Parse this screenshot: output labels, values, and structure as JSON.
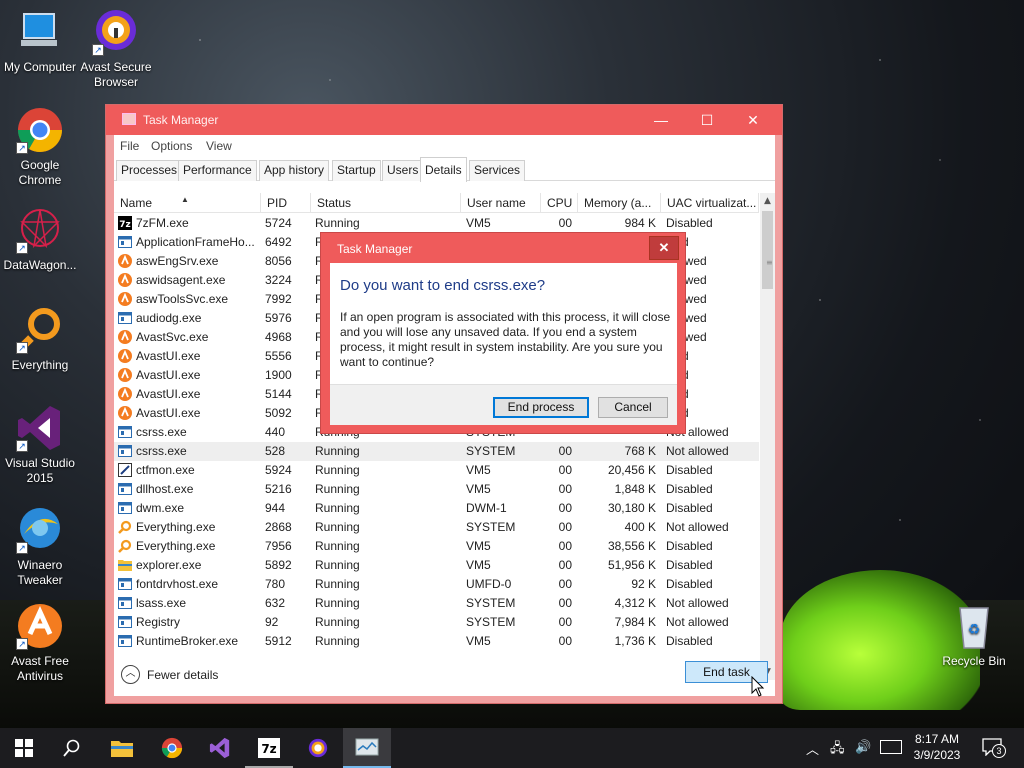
{
  "desktop": {
    "icons": [
      {
        "label": "My Computer",
        "icon": "computer-icon"
      },
      {
        "label": "Avast Secure Browser",
        "icon": "avast-browser-icon"
      },
      {
        "label": "Google Chrome",
        "icon": "chrome-icon"
      },
      {
        "label": "DataWagon...",
        "icon": "datawagon-icon"
      },
      {
        "label": "Everything",
        "icon": "everything-icon"
      },
      {
        "label": "Visual Studio 2015",
        "icon": "visual-studio-icon"
      },
      {
        "label": "Winaero Tweaker",
        "icon": "winaero-icon"
      },
      {
        "label": "Avast Free Antivirus",
        "icon": "avast-antivirus-icon"
      },
      {
        "label": "Recycle Bin",
        "icon": "recycle-bin-icon"
      }
    ]
  },
  "taskmanager": {
    "title": "Task Manager",
    "menu": [
      "File",
      "Options",
      "View"
    ],
    "tabs": [
      "Processes",
      "Performance",
      "App history",
      "Startup",
      "Users",
      "Details",
      "Services"
    ],
    "active_tab": "Details",
    "columns": [
      "Name",
      "PID",
      "Status",
      "User name",
      "CPU",
      "Memory (a...",
      "UAC virtualizat..."
    ],
    "rows": [
      {
        "icon": "7z",
        "name": "7zFM.exe",
        "pid": "5724",
        "status": "Running",
        "user": "VM5",
        "cpu": "00",
        "mem": "984 K",
        "uac": "Disabled"
      },
      {
        "icon": "app",
        "name": "ApplicationFrameHo...",
        "pid": "6492",
        "status": "R",
        "user": "",
        "cpu": "",
        "mem": "",
        "uac": "bled"
      },
      {
        "icon": "avast",
        "name": "aswEngSrv.exe",
        "pid": "8056",
        "status": "R",
        "user": "",
        "cpu": "",
        "mem": "",
        "uac": "allowed"
      },
      {
        "icon": "avast",
        "name": "aswidsagent.exe",
        "pid": "3224",
        "status": "R",
        "user": "",
        "cpu": "",
        "mem": "",
        "uac": "allowed"
      },
      {
        "icon": "avast",
        "name": "aswToolsSvc.exe",
        "pid": "7992",
        "status": "R",
        "user": "",
        "cpu": "",
        "mem": "",
        "uac": "allowed"
      },
      {
        "icon": "app",
        "name": "audiodg.exe",
        "pid": "5976",
        "status": "R",
        "user": "",
        "cpu": "",
        "mem": "",
        "uac": "allowed"
      },
      {
        "icon": "avast",
        "name": "AvastSvc.exe",
        "pid": "4968",
        "status": "R",
        "user": "",
        "cpu": "",
        "mem": "",
        "uac": "allowed"
      },
      {
        "icon": "avast",
        "name": "AvastUI.exe",
        "pid": "5556",
        "status": "R",
        "user": "",
        "cpu": "",
        "mem": "",
        "uac": "bled"
      },
      {
        "icon": "avast",
        "name": "AvastUI.exe",
        "pid": "1900",
        "status": "R",
        "user": "",
        "cpu": "",
        "mem": "",
        "uac": "bled"
      },
      {
        "icon": "avast",
        "name": "AvastUI.exe",
        "pid": "5144",
        "status": "R",
        "user": "",
        "cpu": "",
        "mem": "",
        "uac": "bled"
      },
      {
        "icon": "avast",
        "name": "AvastUI.exe",
        "pid": "5092",
        "status": "R",
        "user": "",
        "cpu": "",
        "mem": "",
        "uac": "bled"
      },
      {
        "icon": "app",
        "name": "csrss.exe",
        "pid": "440",
        "status": "Running",
        "user": "SYSTEM",
        "cpu": "",
        "mem": "",
        "uac": "Not allowed"
      },
      {
        "icon": "app",
        "name": "csrss.exe",
        "pid": "528",
        "status": "Running",
        "user": "SYSTEM",
        "cpu": "00",
        "mem": "768 K",
        "uac": "Not allowed",
        "selected": true
      },
      {
        "icon": "pen",
        "name": "ctfmon.exe",
        "pid": "5924",
        "status": "Running",
        "user": "VM5",
        "cpu": "00",
        "mem": "20,456 K",
        "uac": "Disabled"
      },
      {
        "icon": "app",
        "name": "dllhost.exe",
        "pid": "5216",
        "status": "Running",
        "user": "VM5",
        "cpu": "00",
        "mem": "1,848 K",
        "uac": "Disabled"
      },
      {
        "icon": "app",
        "name": "dwm.exe",
        "pid": "944",
        "status": "Running",
        "user": "DWM-1",
        "cpu": "00",
        "mem": "30,180 K",
        "uac": "Disabled"
      },
      {
        "icon": "search",
        "name": "Everything.exe",
        "pid": "2868",
        "status": "Running",
        "user": "SYSTEM",
        "cpu": "00",
        "mem": "400 K",
        "uac": "Not allowed"
      },
      {
        "icon": "search",
        "name": "Everything.exe",
        "pid": "7956",
        "status": "Running",
        "user": "VM5",
        "cpu": "00",
        "mem": "38,556 K",
        "uac": "Disabled"
      },
      {
        "icon": "folder",
        "name": "explorer.exe",
        "pid": "5892",
        "status": "Running",
        "user": "VM5",
        "cpu": "00",
        "mem": "51,956 K",
        "uac": "Disabled"
      },
      {
        "icon": "app",
        "name": "fontdrvhost.exe",
        "pid": "780",
        "status": "Running",
        "user": "UMFD-0",
        "cpu": "00",
        "mem": "92 K",
        "uac": "Disabled"
      },
      {
        "icon": "app",
        "name": "lsass.exe",
        "pid": "632",
        "status": "Running",
        "user": "SYSTEM",
        "cpu": "00",
        "mem": "4,312 K",
        "uac": "Not allowed"
      },
      {
        "icon": "app",
        "name": "Registry",
        "pid": "92",
        "status": "Running",
        "user": "SYSTEM",
        "cpu": "00",
        "mem": "7,984 K",
        "uac": "Not allowed"
      },
      {
        "icon": "app",
        "name": "RuntimeBroker.exe",
        "pid": "5912",
        "status": "Running",
        "user": "VM5",
        "cpu": "00",
        "mem": "1,736 K",
        "uac": "Disabled"
      }
    ],
    "fewer_details": "Fewer details",
    "end_task": "End task"
  },
  "dialog": {
    "title": "Task Manager",
    "heading": "Do you want to end csrss.exe?",
    "message": "If an open program is associated with this process, it will close and you will lose any unsaved data. If you end a system process, it might result in system instability. Are you sure you want to continue?",
    "end_process": "End process",
    "cancel": "Cancel",
    "close_glyph": "✕"
  },
  "taskbar": {
    "items": [
      {
        "icon": "windows-start-icon",
        "state": "none"
      },
      {
        "icon": "search-icon",
        "state": "none"
      },
      {
        "icon": "file-explorer-icon",
        "state": "none"
      },
      {
        "icon": "chrome-icon",
        "state": "none"
      },
      {
        "icon": "visual-studio-icon",
        "state": "none"
      },
      {
        "icon": "7zip-icon",
        "state": "running"
      },
      {
        "icon": "avast-browser-icon",
        "state": "none"
      },
      {
        "icon": "task-manager-icon",
        "state": "active"
      }
    ],
    "time": "8:17 AM",
    "date": "3/9/2023",
    "notifications_count": "3"
  },
  "colors": {
    "accent_red": "#ef5b5b",
    "selection": "#cde8fa",
    "heading_blue": "#1f3c88"
  }
}
